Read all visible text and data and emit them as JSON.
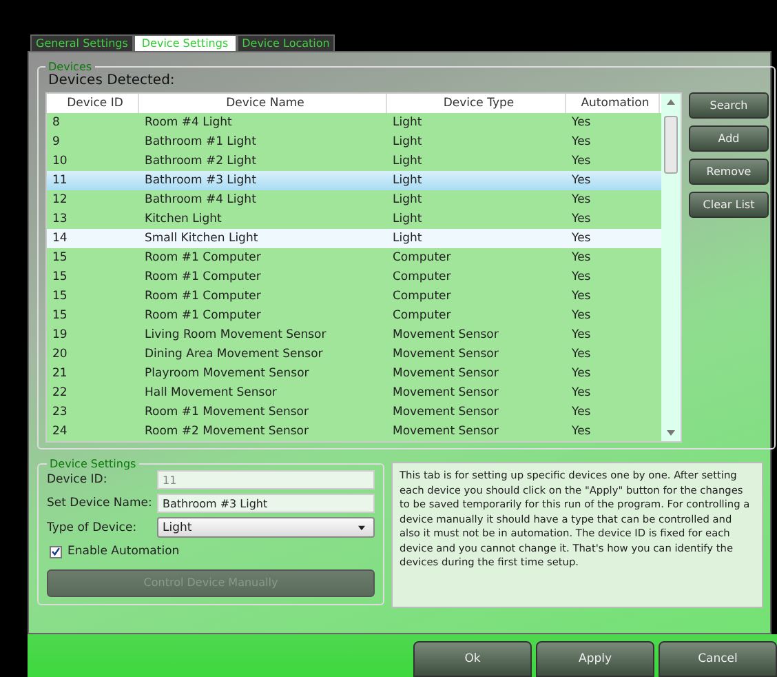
{
  "tabs": [
    {
      "label": "General Settings",
      "selected": false
    },
    {
      "label": "Device Settings",
      "selected": true
    },
    {
      "label": "Device Location",
      "selected": false
    }
  ],
  "devices": {
    "legend": "Devices",
    "heading": "Devices Detected:",
    "columns": [
      "Device ID",
      "Device Name",
      "Device Type",
      "Automation"
    ],
    "rows": [
      {
        "id": "8",
        "name": "Room #4 Light",
        "type": "Light",
        "automation": "Yes",
        "selected": false,
        "hovered": false
      },
      {
        "id": "9",
        "name": "Bathroom #1 Light",
        "type": "Light",
        "automation": "Yes",
        "selected": false,
        "hovered": false
      },
      {
        "id": "10",
        "name": "Bathroom #2 Light",
        "type": "Light",
        "automation": "Yes",
        "selected": false,
        "hovered": false
      },
      {
        "id": "11",
        "name": "Bathroom #3 Light",
        "type": "Light",
        "automation": "Yes",
        "selected": true,
        "hovered": false
      },
      {
        "id": "12",
        "name": "Bathroom #4 Light",
        "type": "Light",
        "automation": "Yes",
        "selected": false,
        "hovered": false
      },
      {
        "id": "13",
        "name": "Kitchen Light",
        "type": "Light",
        "automation": "Yes",
        "selected": false,
        "hovered": false
      },
      {
        "id": "14",
        "name": "Small Kitchen Light",
        "type": "Light",
        "automation": "Yes",
        "selected": false,
        "hovered": true
      },
      {
        "id": "15",
        "name": "Room #1 Computer",
        "type": "Computer",
        "automation": "Yes",
        "selected": false,
        "hovered": false
      },
      {
        "id": "15",
        "name": "Room #1 Computer",
        "type": "Computer",
        "automation": "Yes",
        "selected": false,
        "hovered": false
      },
      {
        "id": "15",
        "name": "Room #1 Computer",
        "type": "Computer",
        "automation": "Yes",
        "selected": false,
        "hovered": false
      },
      {
        "id": "15",
        "name": "Room #1 Computer",
        "type": "Computer",
        "automation": "Yes",
        "selected": false,
        "hovered": false
      },
      {
        "id": "19",
        "name": "Living Room Movement Sensor",
        "type": "Movement Sensor",
        "automation": "Yes",
        "selected": false,
        "hovered": false
      },
      {
        "id": "20",
        "name": "Dining Area Movement Sensor",
        "type": "Movement Sensor",
        "automation": "Yes",
        "selected": false,
        "hovered": false
      },
      {
        "id": "21",
        "name": "Playroom Movement Sensor",
        "type": "Movement Sensor",
        "automation": "Yes",
        "selected": false,
        "hovered": false
      },
      {
        "id": "22",
        "name": "Hall Movement Sensor",
        "type": "Movement Sensor",
        "automation": "Yes",
        "selected": false,
        "hovered": false
      },
      {
        "id": "23",
        "name": "Room #1 Movement Sensor",
        "type": "Movement Sensor",
        "automation": "Yes",
        "selected": false,
        "hovered": false
      },
      {
        "id": "24",
        "name": "Room #2 Movement Sensor",
        "type": "Movement Sensor",
        "automation": "Yes",
        "selected": false,
        "hovered": false
      }
    ],
    "buttons": [
      "Search",
      "Add",
      "Remove",
      "Clear List"
    ]
  },
  "device_settings": {
    "legend": "Device Settings",
    "id_label": "Device ID:",
    "id_value": "11",
    "id_disabled": true,
    "name_label": "Set Device Name:",
    "name_value": "Bathroom #3 Light",
    "type_label": "Type of Device:",
    "type_value": "Light",
    "automation_label": "Enable Automation",
    "automation_checked": true,
    "manual_button": "Control Device Manually",
    "manual_disabled": true
  },
  "help_text": "This tab is for setting up specific devices one by one. After setting each device you should click on the \"Apply\" button for the changes to be saved temporarily for this run of the program. For controlling a device manually it should have a type that can be controlled and also it must not be in automation. The device ID is fixed for each device and you cannot change it. That's how you can identify the devices during the first time setup.",
  "footer_buttons": [
    "Ok",
    "Apply",
    "Cancel"
  ]
}
